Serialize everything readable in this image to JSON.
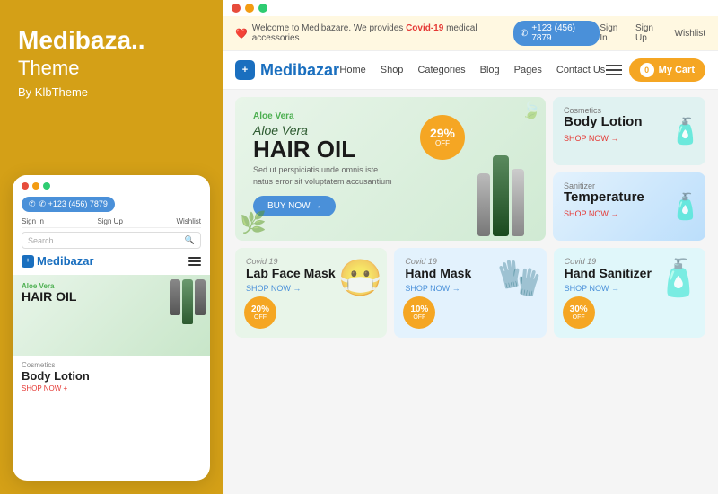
{
  "leftPanel": {
    "title": "Medibaza..",
    "subtitle": "Theme",
    "by": "By KlbTheme"
  },
  "mobileMockup": {
    "dots": [
      "#e74c3c",
      "#f39c12",
      "#2ecc71"
    ],
    "phoneBadge": "✆ +123 (456) 7879",
    "navLinks": [
      "Sign In",
      "Sign Up",
      "Wishlist"
    ],
    "searchPlaceholder": "Search",
    "logoText": "Medibazar",
    "heroSubtitle": "Aloe Vera",
    "heroTitle": "HAIR OIL",
    "bodyLotionLabel": "Cosmetics",
    "bodyLotionTitle": "Body Lotion",
    "bodyLotionShop": "SHOP NOW +"
  },
  "desktopMockup": {
    "dots": [
      "#e74c3c",
      "#f39c12",
      "#2ecc71"
    ],
    "announcement": {
      "welcome": "Welcome to Medibazare. We provides",
      "covidLink": "Covid-19",
      "covidSuffix": "medical accessories",
      "phone": "+123 (456) 7879",
      "signIn": "Sign In",
      "signUp": "Sign Up",
      "wishlist": "Wishlist"
    },
    "nav": {
      "logo": "Medibazar",
      "links": [
        "Home",
        "Shop",
        "Categories",
        "Blog",
        "Pages",
        "Contact Us"
      ],
      "cartLabel": "My Cart",
      "cartCount": "0"
    },
    "hero": {
      "badge": "Aloe Vera",
      "title": "HAIR OIL",
      "discount": "29%",
      "discountSub": "OFF",
      "description": "Sed ut perspiciatis unde omnis iste natus error sit voluptatem accusantium",
      "buyNow": "BUY NOW →"
    },
    "sideCards": [
      {
        "label": "Cosmetics",
        "title": "Body Lotion",
        "shop": "SHOP NOW →",
        "icon": "🧴"
      },
      {
        "label": "Sanitizer",
        "title": "Temperature",
        "shop": "SHOP NOW →",
        "icon": "🧴"
      }
    ],
    "bottomCards": [
      {
        "label": "Covid 19",
        "title": "Lab Face Mask",
        "shop": "SHOP NOW →",
        "discount": "20%",
        "discountSub": "OFF",
        "icon": "😷"
      },
      {
        "label": "Covid 19",
        "title": "Hand Mask",
        "shop": "SHOP NOW →",
        "discount": "10%",
        "discountSub": "OFF",
        "icon": "🧤"
      },
      {
        "label": "Covid 19",
        "title": "Hand Sanitizer",
        "shop": "SHOP NOW →",
        "discount": "30%",
        "discountSub": "OFF",
        "icon": "🧴"
      }
    ]
  }
}
